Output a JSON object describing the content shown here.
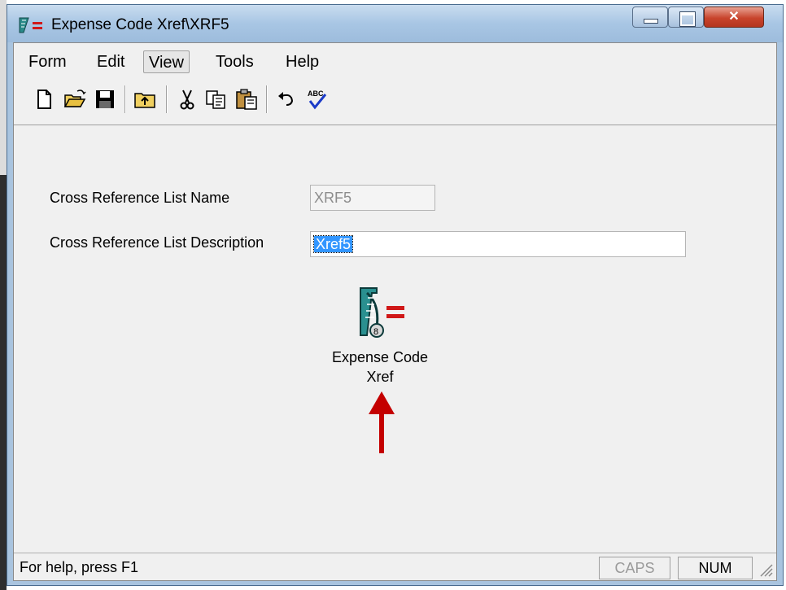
{
  "window": {
    "title": "Expense Code Xref\\XRF5"
  },
  "menu": [
    "Form",
    "Edit",
    "View",
    "Tools",
    "Help"
  ],
  "toolbar": {
    "icons": [
      "new-document-icon",
      "open-folder-icon",
      "save-disk-icon",
      "up-folder-icon",
      "cut-scissors-icon",
      "copy-icon",
      "paste-icon",
      "undo-icon",
      "spellcheck-icon"
    ]
  },
  "form": {
    "name_label": "Cross Reference List Name",
    "name_value": "XRF5",
    "desc_label": "Cross Reference List Description",
    "desc_value": "Xref5"
  },
  "icon_caption": {
    "line1": "Expense Code",
    "line2": "Xref"
  },
  "status": {
    "help": "For help, press F1",
    "caps": "CAPS",
    "num": "NUM"
  },
  "colors": {
    "arrow": "#c40000",
    "selection": "#3296ff",
    "titlebar": "#a8c6e4"
  }
}
